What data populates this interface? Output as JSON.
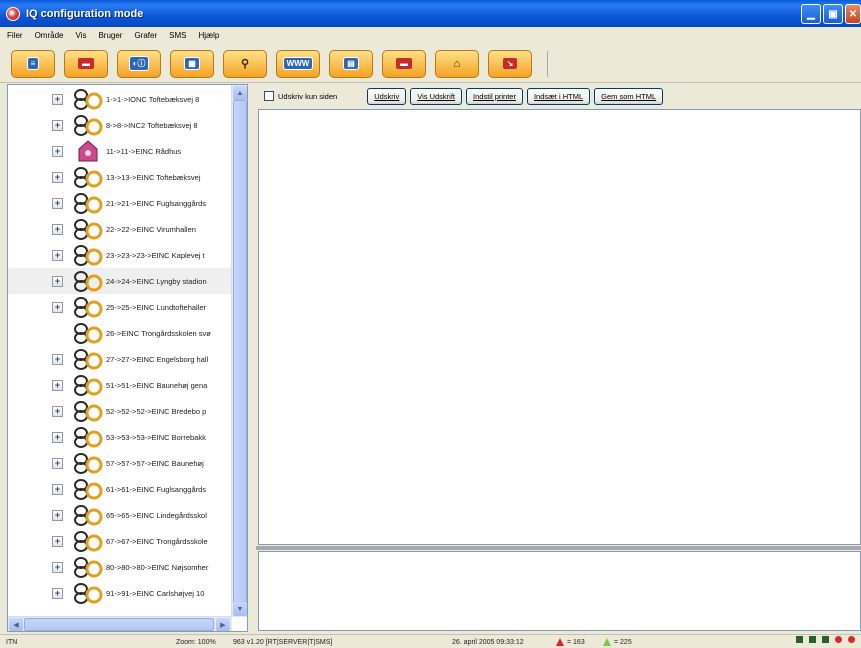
{
  "window": {
    "title": "IQ configuration mode",
    "controls": [
      "minimize-icon",
      "maximize-icon",
      "close-icon"
    ]
  },
  "menu": [
    "Filer",
    "Område",
    "Vis",
    "Bruger",
    "Grafer",
    "SMS",
    "Hjælp"
  ],
  "toolbar": {
    "buttons": [
      {
        "icon": "list-icon",
        "glyph": "≡"
      },
      {
        "icon": "install-icon",
        "glyph": "▬"
      },
      {
        "icon": "info-icon",
        "glyph": "◐ⓘ"
      },
      {
        "icon": "config-icon",
        "glyph": "▦"
      },
      {
        "icon": "search-icon",
        "glyph": "⚲"
      },
      {
        "icon": "www-icon",
        "glyph": "WWW"
      },
      {
        "icon": "report-icon",
        "glyph": "▤"
      },
      {
        "icon": "minus-icon",
        "glyph": "▬"
      },
      {
        "icon": "house-icon",
        "glyph": "⌂"
      },
      {
        "icon": "arrow-icon",
        "glyph": "↘"
      }
    ]
  },
  "tree": {
    "items": [
      {
        "label": "1->1->IONC Toftebæksvej 8",
        "icon": "meter-icon",
        "expander": "+",
        "selected": false
      },
      {
        "label": "8->8->INC2 Toftebæksvej 8",
        "icon": "meter-icon",
        "expander": "+",
        "selected": false
      },
      {
        "label": "11->11->EINC Rådhus",
        "icon": "building-icon",
        "expander": "+",
        "selected": false
      },
      {
        "label": "13->13->EINC Toftebæksvej",
        "icon": "meter-icon",
        "expander": "+",
        "selected": false
      },
      {
        "label": "21->21->EINC Fuglsanggårds",
        "icon": "meter-icon",
        "expander": "+",
        "selected": false
      },
      {
        "label": "22->22->EINC Virumhallen",
        "icon": "meter-icon",
        "expander": "+",
        "selected": false
      },
      {
        "label": "23->23->23->EINC Kaplevej t",
        "icon": "meter-icon",
        "expander": "+",
        "selected": false
      },
      {
        "label": "24->24->EINC Lyngby stadion",
        "icon": "meter-icon",
        "expander": "+",
        "selected": true
      },
      {
        "label": "25->25->EINC Lundtoftehaller",
        "icon": "meter-icon",
        "expander": "+",
        "selected": false
      },
      {
        "label": "26->EINC Trongårdsskolen svø",
        "icon": "meter-icon",
        "expander": "",
        "selected": false
      },
      {
        "label": "27->27->EINC Engelsborg hall",
        "icon": "meter-icon",
        "expander": "+",
        "selected": false
      },
      {
        "label": "51->51->EINC Baunehøj gena",
        "icon": "meter-icon",
        "expander": "+",
        "selected": false
      },
      {
        "label": "52->52->52->EINC Bredebo p",
        "icon": "meter-icon",
        "expander": "+",
        "selected": false
      },
      {
        "label": "53->53->53->EINC Borrebakk",
        "icon": "meter-icon",
        "expander": "+",
        "selected": false
      },
      {
        "label": "57->57->57->EINC Baunehøj",
        "icon": "meter-icon",
        "expander": "+",
        "selected": false
      },
      {
        "label": "61->61->EINC Fuglsanggårds",
        "icon": "meter-icon",
        "expander": "+",
        "selected": false
      },
      {
        "label": "65->65->EINC Lindegårdsskol",
        "icon": "meter-icon",
        "expander": "+",
        "selected": false
      },
      {
        "label": "67->67->EINC Trongårdsskole",
        "icon": "meter-icon",
        "expander": "+",
        "selected": false
      },
      {
        "label": "80->80->80->EINC Nøjsomher",
        "icon": "meter-icon",
        "expander": "+",
        "selected": false
      },
      {
        "label": "91->91->EINC Carlshøjvej 10",
        "icon": "meter-icon",
        "expander": "+",
        "selected": false
      }
    ]
  },
  "report_toolbar": {
    "checkbox_label": "Udskriv kun siden",
    "buttons": [
      "Udskriv",
      "Vis Udskrift",
      "Indstil printer",
      "Indsæt i HTML",
      "Gem som HTML"
    ]
  },
  "statusbar": {
    "left": "ITN",
    "zoom": "Zoom: 100%",
    "server": "963 v1.20 [RT|SERVER|T|SMS]",
    "datetime": "26. april 2005 09:33:12",
    "red_count": "= 163",
    "green_count": "= 225"
  },
  "colors": {
    "titlebar": "#0a5bd8",
    "toolbar_button": "#f3a223",
    "selected_row": "#efefef",
    "tree_border": "#7f9db9"
  }
}
